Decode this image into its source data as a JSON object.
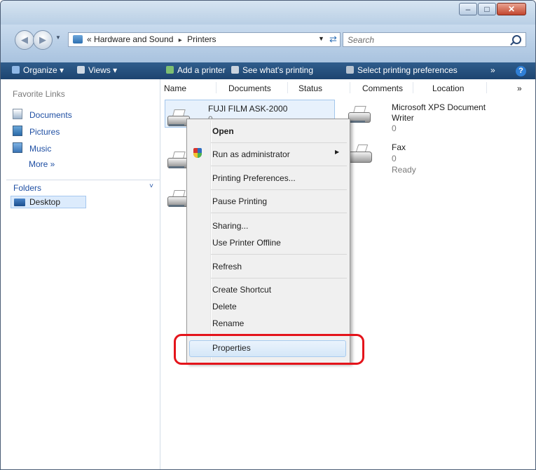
{
  "window": {
    "controls": {
      "minimize": "–",
      "maximize": "□",
      "close": "✕"
    }
  },
  "address": {
    "crumbs": [
      "«",
      "Hardware and Sound",
      "▸",
      "Printers"
    ],
    "search_placeholder": "Search"
  },
  "toolbar": {
    "items": [
      "Organize ▾",
      "Views ▾",
      "Add a printer",
      "See what's printing",
      "Select printing preferences",
      "»"
    ],
    "help": "?"
  },
  "nav": {
    "favorites_heading": "Favorite Links",
    "links": [
      "Documents",
      "Pictures",
      "Music"
    ],
    "more": "More »",
    "folders_label": "Folders",
    "folders_chevron": "˅",
    "desktop": "Desktop"
  },
  "columns": [
    "Name",
    "Documents",
    "Status",
    "Comments",
    "Location",
    "»"
  ],
  "printers": {
    "selected": {
      "name": "FUJI FILM ASK-2000",
      "docs": "0"
    },
    "xps": {
      "name_line1": "Microsoft XPS Document",
      "name_line2": "Writer",
      "docs": "0"
    },
    "fax": {
      "name": "Fax",
      "docs": "0",
      "status": "Ready"
    }
  },
  "context_menu": {
    "open": "Open",
    "run_as_admin": "Run as administrator",
    "printing_preferences": "Printing Preferences...",
    "pause_printing": "Pause Printing",
    "sharing": "Sharing...",
    "use_offline": "Use Printer Offline",
    "refresh": "Refresh",
    "create_shortcut": "Create Shortcut",
    "delete": "Delete",
    "rename": "Rename",
    "properties": "Properties"
  },
  "colors": {
    "toolbar": "#1d4470",
    "link": "#1f4fa3",
    "annotation": "#e4141b",
    "selection": "#e7f1fc"
  }
}
